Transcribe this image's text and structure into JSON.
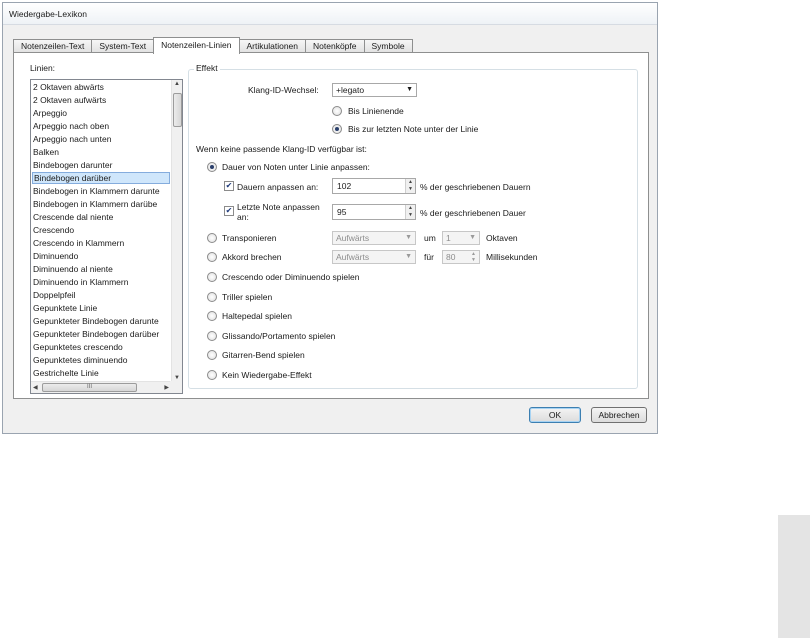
{
  "window": {
    "title": "Wiedergabe-Lexikon"
  },
  "tabs": [
    {
      "label": "Notenzeilen-Text",
      "active": false
    },
    {
      "label": "System-Text",
      "active": false
    },
    {
      "label": "Notenzeilen-Linien",
      "active": true
    },
    {
      "label": "Artikulationen",
      "active": false
    },
    {
      "label": "Notenköpfe",
      "active": false
    },
    {
      "label": "Symbole",
      "active": false
    }
  ],
  "lines": {
    "label": "Linien:",
    "items": [
      "2 Oktaven abwärts",
      "2 Oktaven aufwärts",
      "Arpeggio",
      "Arpeggio nach oben",
      "Arpeggio nach unten",
      "Balken",
      "Bindebogen darunter",
      "Bindebogen darüber",
      "Bindebogen in Klammern darunte",
      "Bindebogen in Klammern darübe",
      "Crescende dal niente",
      "Crescendo",
      "Crescendo in Klammern",
      "Diminuendo",
      "Diminuendo al niente",
      "Diminuendo in Klammern",
      "Doppelpfeil",
      "Gepunktete Linie",
      "Gepunkteter Bindebogen darunte",
      "Gepunkteter Bindebogen darüber",
      "Gepunktetes crescendo",
      "Gepunktetes diminuendo",
      "Gestrichelte Linie"
    ],
    "selected_index": 7,
    "hscroll_grip": "III"
  },
  "effect": {
    "group_label": "Effekt",
    "klang_label": "Klang-ID-Wechsel:",
    "klang_value": "+legato",
    "radio_bis_ende": "Bis Linienende",
    "radio_bis_letzten": "Bis zur letzten Note unter der Linie",
    "radio_selected": "bis_letzten"
  },
  "fallback": {
    "heading": "Wenn keine passende Klang-ID verfügbar ist:",
    "dauer_anpassen": "Dauer von Noten unter Linie anpassen:",
    "dauern_label": "Dauern anpassen an:",
    "dauern_value": "102",
    "dauern_unit": "% der geschriebenen Dauern",
    "letzte_label_1": "Letzte Note anpassen",
    "letzte_label_2": "an:",
    "letzte_value": "95",
    "letzte_unit": "% der geschriebenen Dauer",
    "transponieren": "Transponieren",
    "trans_select": "Aufwärts",
    "um": "um",
    "oktaven_value": "1",
    "oktaven": "Oktaven",
    "akkord": "Akkord brechen",
    "akkord_select": "Aufwärts",
    "fuer": "für",
    "ms_value": "80",
    "ms_unit": "Millisekunden",
    "crescendo": "Crescendo oder Diminuendo spielen",
    "triller": "Triller spielen",
    "haltepedal": "Haltepedal spielen",
    "glissando": "Glissando/Portamento spielen",
    "gitarren": "Gitarren-Bend spielen",
    "kein": "Kein Wiedergabe-Effekt",
    "selected": "dauer"
  },
  "buttons": {
    "ok": "OK",
    "cancel": "Abbrechen"
  }
}
